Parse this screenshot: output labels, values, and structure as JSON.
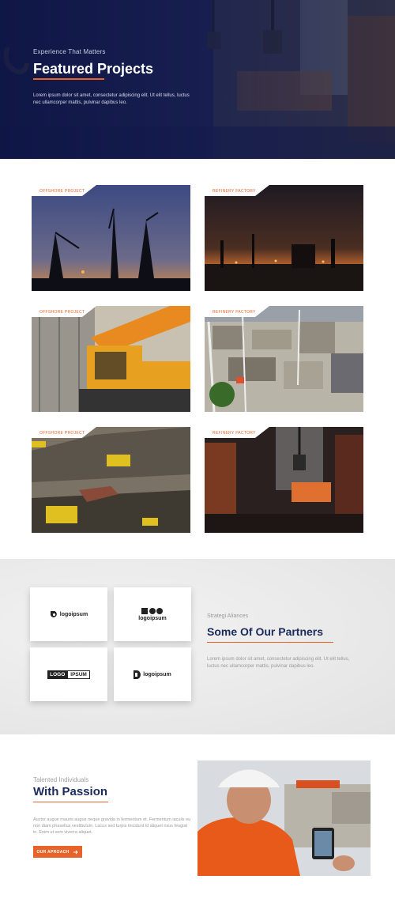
{
  "hero": {
    "subtitle": "Experience That Matters",
    "title": "Featured Projects",
    "text": "Lorem ipsum dolor sit amet, consectetur adipiscing elit. Ut elit tellus, luctus nec ullamcorper mattis, pulvinar dapibus leo."
  },
  "projects": [
    {
      "label": "Offshore Project"
    },
    {
      "label": "Refinery Factory"
    },
    {
      "label": "Offshore Project"
    },
    {
      "label": "Refinery Factory"
    },
    {
      "label": "Offshore Project"
    },
    {
      "label": "Refinery Factory"
    }
  ],
  "partners": {
    "subtitle": "Strategi Aliances",
    "title": "Some Of Our Partners",
    "text": "Lorem ipsum dolor sit amet, consectetur adipiscing elit. Ut elit tellus, luctus nec ullamcorper mattis, pulvinar dapibus leo.",
    "logos": [
      {
        "text": "logoipsum"
      },
      {
        "text": "logoipsum"
      },
      {
        "text_a": "LOGO",
        "text_b": "IPSUM"
      },
      {
        "text": "logoipsum"
      }
    ]
  },
  "passion": {
    "subtitle": "Talented Individuals",
    "title": "With Passion",
    "text": "Auctor augue mauris augue neque gravida in fermentum et. Fermentum iaculis eu non diam phasellus vestibulum. Lacus sed turpis tincidunt id aliquet risus feugiat in. Enim ut sem viverra aliquet.",
    "button_label": "OUR APROACH",
    "button_icon": "arrow-right-icon"
  },
  "colors": {
    "accent": "#e8632a",
    "navy": "#1b2a5c"
  }
}
